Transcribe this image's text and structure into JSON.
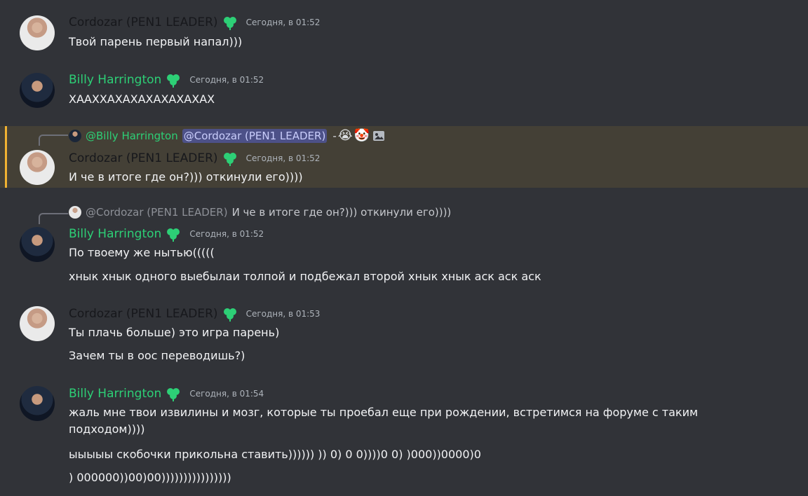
{
  "messages": [
    {
      "author": "Cordozar (PEN1 LEADER)",
      "time": "Сегодня, в 01:52",
      "lines": [
        "Твой парень первый напал)))"
      ]
    },
    {
      "author": "Billy Harrington",
      "time": "Сегодня, в 01:52",
      "lines": [
        "ХААХХАХАХАХАХАХАХАХ"
      ]
    },
    {
      "author": "Cordozar (PEN1 LEADER)",
      "time": "Сегодня, в 01:52",
      "reply": {
        "author": "@Billy Harrington",
        "mention": "@Cordozar (PEN1 LEADER)",
        "separator": "-",
        "emojis": [
          "😭",
          "🤡"
        ],
        "icon": "image-icon"
      },
      "lines": [
        "И че в итоге где он?))) откинули его))))"
      ]
    },
    {
      "author": "Billy Harrington",
      "time": "Сегодня, в 01:52",
      "reply": {
        "author": "@Cordozar (PEN1 LEADER)",
        "text": "И че в итоге где он?))) откинули его))))"
      },
      "lines": [
        "По твоему же нытью(((((",
        "хнык хнык одного выебылаи толпой и подбежал второй хнык хнык аск аск аск"
      ]
    },
    {
      "author": "Cordozar (PEN1 LEADER)",
      "time": "Сегодня, в 01:53",
      "lines": [
        "Ты плачь больше) это игра парень)",
        "Зачем ты в оос переводишь?)"
      ]
    },
    {
      "author": "Billy Harrington",
      "time": "Сегодня, в 01:54",
      "lines": [
        "жаль мне твои извилины и мозг, которые ты проебал еще при рождении, встретимся на форуме с таким подходом))))",
        "ыыыыы скобочки прикольна ставить)))))) )) 0) 0 0))))0 0) )000))0000)0",
        ") 000000))00)00))))))))))))))))"
      ]
    }
  ],
  "colors": {
    "background": "#313338",
    "billy": "#2dcf76",
    "cordozar": "#17181c",
    "highlight": "#444036",
    "highlight_bar": "#f0b232",
    "mention_pill": "#4d5188",
    "timestamp": "#aeb4bb"
  },
  "icons": {
    "role_badge": "clover-icon",
    "avatar_billy": "avatar",
    "avatar_cordozar": "avatar"
  }
}
